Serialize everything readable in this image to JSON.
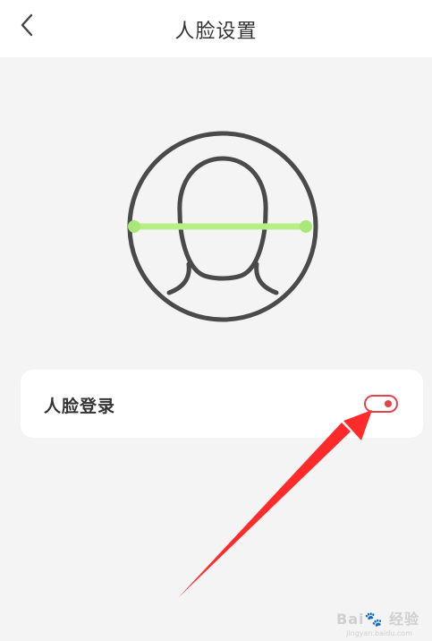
{
  "header": {
    "title": "人脸设置",
    "back_icon": "chevron-left-icon"
  },
  "face_graphic": {
    "icon": "face-scan-icon",
    "scan_line_color": "#b7ef86",
    "stroke_color": "#4a4a4a"
  },
  "settings": {
    "face_login_label": "人脸登录",
    "face_login_enabled": true,
    "toggle_color": "#e3434a"
  },
  "annotation": {
    "arrow_color": "#ff2a2a"
  },
  "watermark": {
    "text": "Bai🐾 经验",
    "subtext": "jingyan.baidu.com"
  }
}
